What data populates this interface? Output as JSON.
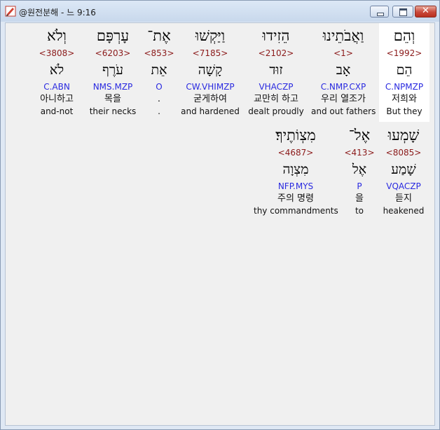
{
  "window": {
    "title": "@원전분해 - 느 9:16",
    "close_glyph": "✕"
  },
  "row1": [
    {
      "hebrew": "וְלֹא",
      "strong": "<3808>",
      "lemma": "לֹא",
      "morph": "C.ABN",
      "korean": "아니하고",
      "english": "and-not"
    },
    {
      "hebrew": "עָרְפָּם",
      "strong": "<6203>",
      "lemma": "עֹרֶף",
      "morph": "NMS.MZP",
      "korean": "목을",
      "english": "their necks"
    },
    {
      "hebrew": "אֶת־",
      "strong": "<853>",
      "lemma": "אֵת",
      "morph": "O",
      "korean": ".",
      "english": "."
    },
    {
      "hebrew": "וַיַּקְשׁוּ",
      "strong": "<7185>",
      "lemma": "קָשָׁה",
      "morph": "CW.VHIMZP",
      "korean": "굳게하여",
      "english": "and hardened"
    },
    {
      "hebrew": "הֵזִידוּ",
      "strong": "<2102>",
      "lemma": "זוּד",
      "morph": "VHACZP",
      "korean": "교만히 하고",
      "english": "dealt proudly"
    },
    {
      "hebrew": "וַאֲבֹתֵינוּ",
      "strong": "<1>",
      "lemma": "אָב",
      "morph": "C.NMP.CXP",
      "korean": "우리 열조가",
      "english": "and out fathers"
    },
    {
      "hebrew": "וְהֵם",
      "strong": "<1992>",
      "lemma": "הֵם",
      "morph": "C.NPMZP",
      "korean": "저희와",
      "english": "But they"
    }
  ],
  "row2": [
    {
      "hebrew": "מִצְוֹתֶיךָ׃",
      "strong": "<4687>",
      "lemma": "מִצְוָה",
      "morph": "NFP.MYS",
      "korean": "주의 명령",
      "english": "thy commandments"
    },
    {
      "hebrew": "אֶל־",
      "strong": "<413>",
      "lemma": "אֶל",
      "morph": "P",
      "korean": "을",
      "english": "to"
    },
    {
      "hebrew": "שָׁמְעוּ",
      "strong": "<8085>",
      "lemma": "שָׁמַע",
      "morph": "VQACZP",
      "korean": "듣지",
      "english": "heakened"
    }
  ]
}
